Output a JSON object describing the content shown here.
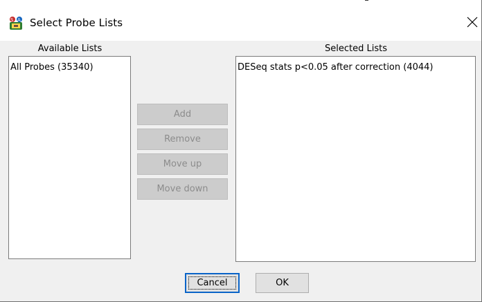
{
  "window": {
    "title": "Select Probe Lists",
    "app_icon": "seqmonk-app-icon",
    "close_icon": "close-icon"
  },
  "available": {
    "header": "Available Lists",
    "items": [
      "All Probes (35340)"
    ]
  },
  "selected": {
    "header": "Selected Lists",
    "items": [
      "DESeq stats p<0.05 after correction (4044)"
    ]
  },
  "actions": {
    "add_label": "Add",
    "remove_label": "Remove",
    "move_up_label": "Move up",
    "move_down_label": "Move down"
  },
  "footer": {
    "cancel_label": "Cancel",
    "ok_label": "OK"
  },
  "colors": {
    "dialog_bg": "#f0f0f0",
    "disabled_button": "#cccccc",
    "disabled_text": "#8c8c8c",
    "focus_border": "#0a64c8"
  }
}
